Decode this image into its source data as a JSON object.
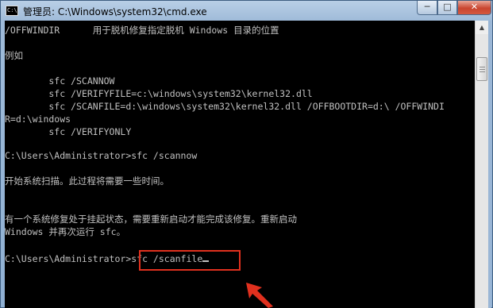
{
  "window": {
    "title": "管理员: C:\\Windows\\system32\\cmd.exe",
    "icon_label": "C:\\"
  },
  "controls": {
    "minimize": "─",
    "maximize": "□",
    "close": "✕"
  },
  "console": {
    "lines": [
      "/OFFWINDIR      用于脱机修复指定脱机 Windows 目录的位置",
      "",
      "例如",
      "",
      "        sfc /SCANNOW",
      "        sfc /VERIFYFILE=c:\\windows\\system32\\kernel32.dll",
      "        sfc /SCANFILE=d:\\windows\\system32\\kernel32.dll /OFFBOOTDIR=d:\\ /OFFWINDI",
      "R=d:\\windows",
      "        sfc /VERIFYONLY",
      "",
      "C:\\Users\\Administrator>sfc /scannow",
      "",
      "开始系统扫描。此过程将需要一些时间。",
      "",
      "",
      "有一个系统修复处于挂起状态，需要重新启动才能完成该修复。重新启动",
      "Windows 并再次运行 sfc。",
      "",
      "C:\\Users\\Administrator>sfc /scanfile"
    ]
  },
  "scrollbar": {
    "up_arrow": "▲",
    "down_arrow": "▼"
  },
  "annotation": {
    "highlight_color": "#e0301e"
  }
}
